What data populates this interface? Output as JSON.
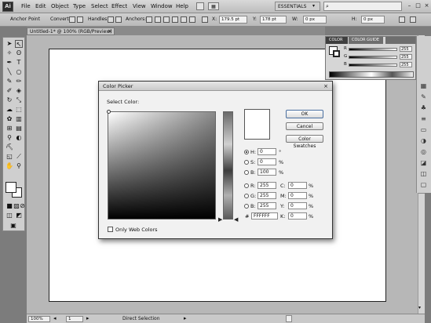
{
  "app": {
    "logo": "Ai"
  },
  "menubar": {
    "items": [
      "File",
      "Edit",
      "Object",
      "Type",
      "Select",
      "Effect",
      "View",
      "Window",
      "Help"
    ],
    "workspace": "ESSENTIALS"
  },
  "controlbar": {
    "mode_label": "Anchor Point",
    "convert_label": "Convert:",
    "handles_label": "Handles:",
    "anchors_label": "Anchors:",
    "x_label": "X:",
    "x_value": "179.5 pt",
    "y_label": "Y:",
    "y_value": "178 pt",
    "w_label": "W:",
    "w_value": "0 px",
    "h_label": "H:",
    "h_value": "0 px"
  },
  "document": {
    "tab_title": "Untitled-1* @ 100% (RGB/Preview)"
  },
  "statusbar": {
    "zoom": "100%",
    "page": "1",
    "tool": "Direct Selection"
  },
  "color_panel": {
    "tabs": [
      "COLOR",
      "COLOR GUIDE"
    ],
    "rows": [
      {
        "label": "R",
        "value": "255"
      },
      {
        "label": "G",
        "value": "255"
      },
      {
        "label": "B",
        "value": "255"
      }
    ]
  },
  "color_picker": {
    "title": "Color Picker",
    "select_label": "Select Color:",
    "buttons": {
      "ok": "OK",
      "cancel": "Cancel",
      "swatches": "Color Swatches"
    },
    "hsb": [
      {
        "label": "H:",
        "value": "0",
        "unit": "°",
        "selected": true
      },
      {
        "label": "S:",
        "value": "0",
        "unit": "%"
      },
      {
        "label": "B:",
        "value": "100",
        "unit": "%"
      }
    ],
    "rgb": [
      {
        "label": "R:",
        "value": "255"
      },
      {
        "label": "G:",
        "value": "255"
      },
      {
        "label": "B:",
        "value": "255"
      }
    ],
    "cmyk": [
      {
        "label": "C:",
        "value": "0",
        "unit": "%"
      },
      {
        "label": "M:",
        "value": "0",
        "unit": "%"
      },
      {
        "label": "Y:",
        "value": "0",
        "unit": "%"
      },
      {
        "label": "K:",
        "value": "0",
        "unit": "%"
      }
    ],
    "hex_label": "#",
    "hex_value": "FFFFFF",
    "web_only_label": "Only Web Colors"
  }
}
